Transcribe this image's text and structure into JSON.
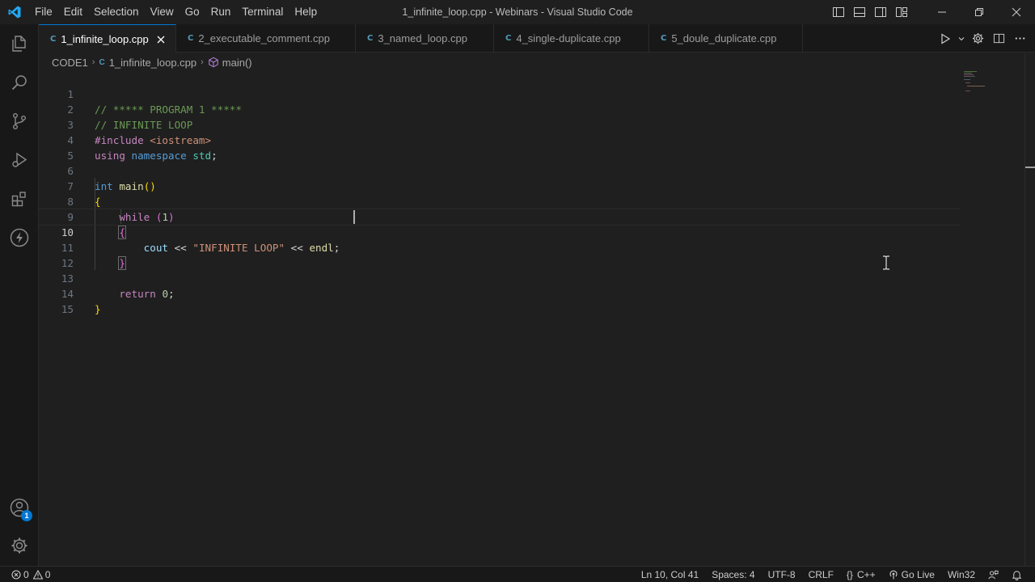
{
  "titlebar": {
    "menu": [
      "File",
      "Edit",
      "Selection",
      "View",
      "Go",
      "Run",
      "Terminal",
      "Help"
    ],
    "title": "1_infinite_loop.cpp - Webinars - Visual Studio Code"
  },
  "tabs": [
    {
      "label": "1_infinite_loop.cpp",
      "active": true
    },
    {
      "label": "2_executable_comment.cpp",
      "active": false
    },
    {
      "label": "3_named_loop.cpp",
      "active": false
    },
    {
      "label": "4_single-duplicate.cpp",
      "active": false
    },
    {
      "label": "5_doule_duplicate.cpp",
      "active": false
    }
  ],
  "tab_icon": "C",
  "breadcrumb": {
    "folder": "CODE1",
    "file": "1_infinite_loop.cpp",
    "symbol": "main()"
  },
  "editor": {
    "line_numbers": [
      "1",
      "2",
      "3",
      "4",
      "5",
      "6",
      "7",
      "8",
      "9",
      "10",
      "11",
      "12",
      "13",
      "14",
      "15"
    ],
    "current_line": 10
  },
  "code": {
    "l1": "// ***** PROGRAM 1 *****",
    "l2": "// INFINITE LOOP",
    "l3_directive": "#include",
    "l3_header": "<iostream>",
    "l4_using": "using",
    "l4_namespace": "namespace",
    "l4_std": "std",
    "l4_semi": ";",
    "l6_int": "int",
    "l6_main": "main",
    "l6_parens": "()",
    "l7": "{",
    "l8_while": "while",
    "l8_open": "(",
    "l8_num": "1",
    "l8_close": ")",
    "l9": "{",
    "l10_cout": "cout",
    "l10_op1": " << ",
    "l10_str": "\"INFINITE LOOP\"",
    "l10_op2": " << ",
    "l10_endl": "endl",
    "l10_semi": ";",
    "l11": "}",
    "l13_return": "return",
    "l13_num": "0",
    "l13_semi": ";",
    "l14": "}"
  },
  "activity_badge": "1",
  "statusbar": {
    "errors": "0",
    "warnings": "0",
    "position": "Ln 10, Col 41",
    "spaces": "Spaces: 4",
    "encoding": "UTF-8",
    "eol": "CRLF",
    "language": "C++",
    "golive": "Go Live",
    "platform": "Win32"
  },
  "colors": {
    "accent": "#0078d4",
    "editor_bg": "#1f1f1f",
    "sidebar_bg": "#181818"
  },
  "icons": [
    "vscode-logo-icon",
    "explorer-icon",
    "search-icon",
    "source-control-icon",
    "run-debug-icon",
    "extensions-icon",
    "thunder-icon",
    "account-icon",
    "manage-gear-icon",
    "run-icon",
    "settings-gear-icon",
    "split-editor-icon",
    "more-icon",
    "close-icon",
    "symbol-method-icon",
    "error-icon",
    "warning-icon",
    "braces-icon",
    "broadcast-icon",
    "person-feedback-icon",
    "bell-icon"
  ]
}
